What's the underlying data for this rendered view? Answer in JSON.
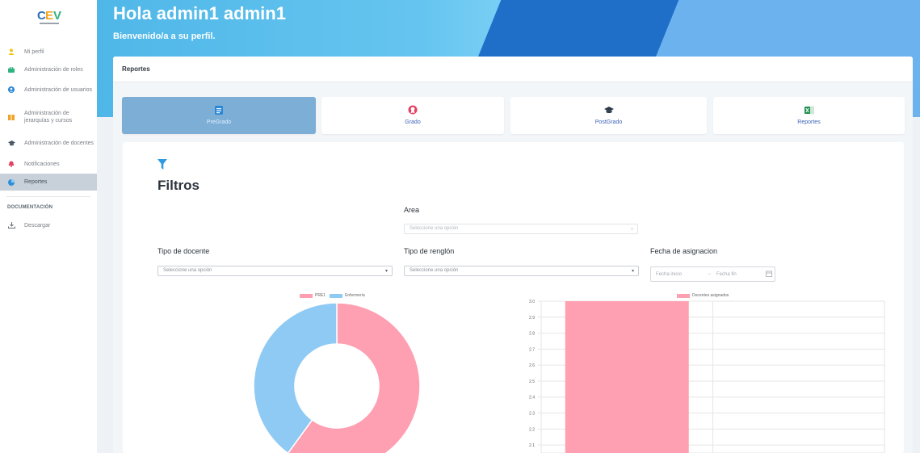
{
  "sidebar": {
    "items": [
      {
        "label": "Mi perfil",
        "icon": "user-icon",
        "color": "#f0c419"
      },
      {
        "label": "Administración de roles",
        "icon": "briefcase-icon",
        "color": "#2fb380"
      },
      {
        "label": "Administración de usuarios",
        "icon": "user-circle-icon",
        "color": "#2b87d6"
      },
      {
        "label": "Administración de jerarquías y cursos",
        "icon": "books-icon",
        "color": "#f0a32a"
      },
      {
        "label": "Administración de docentes",
        "icon": "graduation-cap-icon",
        "color": "#4a5866"
      },
      {
        "label": "Notificaciones",
        "icon": "bell-icon",
        "color": "#e4405f"
      },
      {
        "label": "Reportes",
        "icon": "chart-pie-icon",
        "color": "#2f8fd8"
      }
    ],
    "active_index": 6,
    "section_title": "DOCUMENTACIÓN",
    "download_label": "Descargar"
  },
  "header": {
    "title": "Hola admin1 admin1",
    "subtitle": "Bienvenido/a a su perfil."
  },
  "card": {
    "title": "Reportes"
  },
  "tabs": [
    {
      "label": "PreGrado",
      "icon": "document-icon",
      "active": true
    },
    {
      "label": "Grado",
      "icon": "certificate-icon",
      "active": false
    },
    {
      "label": "PostGrado",
      "icon": "graduation-cap-icon",
      "active": false
    },
    {
      "label": "Reportes",
      "icon": "excel-icon",
      "active": false
    }
  ],
  "filters": {
    "heading": "Filtros",
    "area": {
      "label": "Area",
      "placeholder": "Seleccione una opción"
    },
    "tipo_docente": {
      "label": "Tipo de docente",
      "placeholder": "Seleccione una opción"
    },
    "tipo_renglon": {
      "label": "Tipo de renglón",
      "placeholder": "Seleccione una opción"
    },
    "fecha": {
      "label": "Fecha de asignacion",
      "start_placeholder": "Fecha inicio",
      "separator": "→",
      "end_placeholder": "Fecha fin"
    }
  },
  "colors": {
    "pink": "#ff9fb2",
    "blue": "#8ecaf3",
    "tab_active": "#7dafd6",
    "link": "#3d63b8"
  },
  "chart_data": [
    {
      "type": "pie",
      "variant": "doughnut",
      "labels": [
        "PRE1",
        "Enfermería"
      ],
      "values": [
        60,
        40
      ],
      "colors": [
        "#ff9fb2",
        "#8ecaf3"
      ],
      "legend_position": "top"
    },
    {
      "type": "bar",
      "series": [
        {
          "name": "Docentes asignados",
          "values": [
            3
          ]
        }
      ],
      "colors": [
        "#ff9fb2"
      ],
      "y_ticks": [
        "3.0",
        "2.9",
        "2.8",
        "2.7",
        "2.6",
        "2.5",
        "2.4",
        "2.3",
        "2.2",
        "2.1"
      ],
      "ylim_visible": [
        2.05,
        3.0
      ],
      "grid": true,
      "legend_position": "top"
    }
  ]
}
